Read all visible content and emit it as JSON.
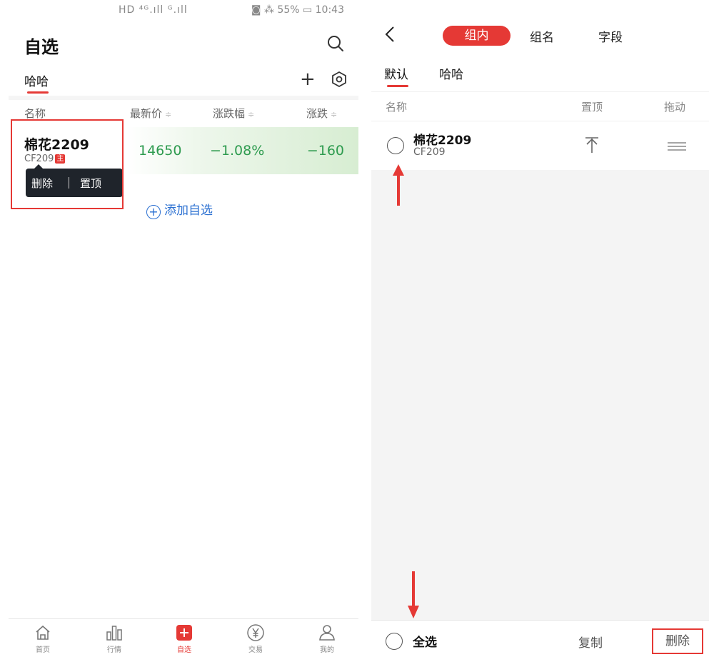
{
  "left": {
    "status": {
      "left_text": "HD ⁴ᴳ.ıll ᴳ.ıll",
      "right_text": "◙ ⁂ 55% ▭ 10:43"
    },
    "title": "自选",
    "group_tab": "哈哈",
    "columns": [
      {
        "label": "名称"
      },
      {
        "label": "最新价",
        "sort": "≑"
      },
      {
        "label": "涨跌幅",
        "sort": "≑"
      },
      {
        "label": "涨跌",
        "sort": "≑"
      }
    ],
    "row": {
      "name": "棉花2209",
      "code": "CF209",
      "badge": "主",
      "price": "14650",
      "change_pct": "−1.08%",
      "change": "−160"
    },
    "context_menu": {
      "delete": "删除",
      "pin_top": "置顶"
    },
    "add_label": "添加自选",
    "add_symbol": "+",
    "tabbar": [
      {
        "label": "首页",
        "icon": "home-icon"
      },
      {
        "label": "行情",
        "icon": "chart-bars-icon"
      },
      {
        "label": "自选",
        "icon": "plus-square-icon",
        "active": true
      },
      {
        "label": "交易",
        "icon": "yen-circle-icon"
      },
      {
        "label": "我的",
        "icon": "person-icon"
      }
    ]
  },
  "right": {
    "segments": [
      "组内",
      "组名",
      "字段"
    ],
    "subtabs": [
      "默认",
      "哈哈"
    ],
    "columns": [
      "名称",
      "置顶",
      "拖动"
    ],
    "row": {
      "name": "棉花2209",
      "code": "CF209"
    },
    "footer": {
      "select_all": "全选",
      "copy": "复制",
      "delete": "删除"
    }
  },
  "colors": {
    "accent": "#e53935",
    "down_green": "#2e9b4f",
    "link_blue": "#2a6fd1"
  }
}
